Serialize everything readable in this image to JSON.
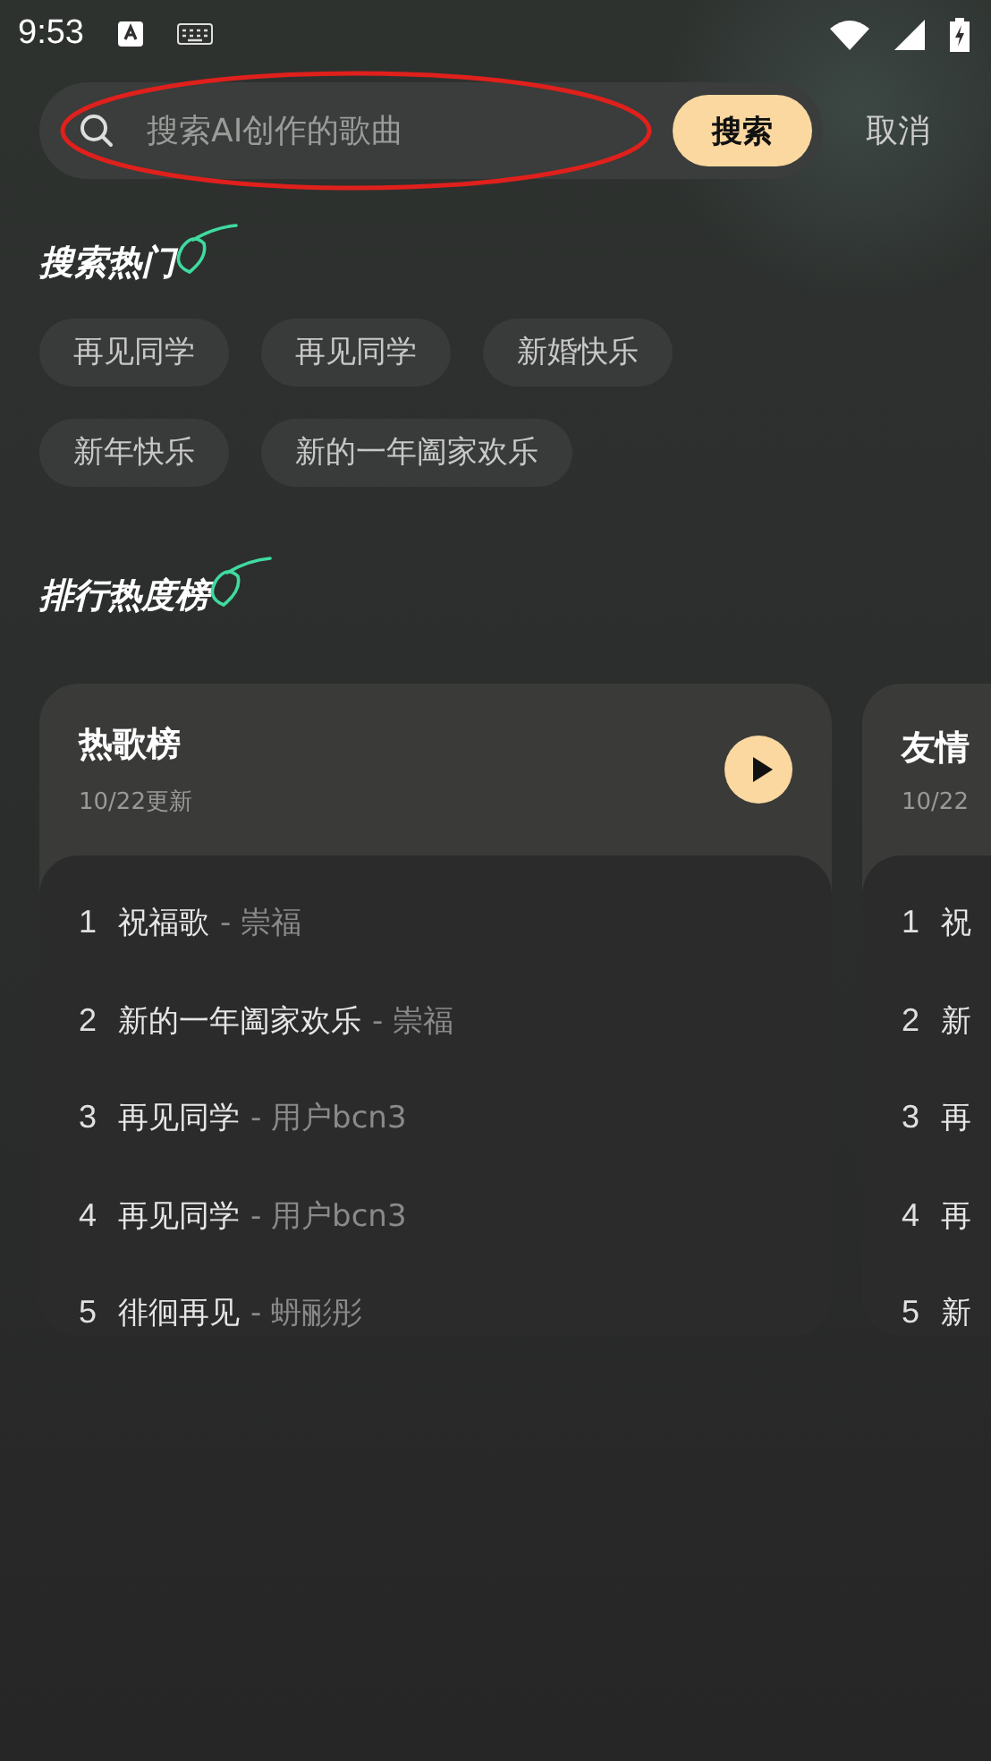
{
  "status_bar": {
    "time": "9:53"
  },
  "search": {
    "placeholder": "搜索AI创作的歌曲",
    "button": "搜索",
    "cancel": "取消",
    "annotation": {
      "kind": "ellipse"
    }
  },
  "hot_search": {
    "title": "搜索热门",
    "tags": [
      "再见同学",
      "再见同学",
      "新婚快乐",
      "新年快乐",
      "新的一年阖家欢乐"
    ]
  },
  "rankings": {
    "title": "排行热度榜",
    "charts": [
      {
        "name": "热歌榜",
        "updated": "10/22更新",
        "play": true,
        "songs": [
          {
            "rank": "1",
            "title": "祝福歌",
            "artist": "- 崇福"
          },
          {
            "rank": "2",
            "title": "新的一年阖家欢乐",
            "artist": "- 崇福"
          },
          {
            "rank": "3",
            "title": "再见同学",
            "artist": "- 用户bcn3"
          },
          {
            "rank": "4",
            "title": "再见同学",
            "artist": "- 用户bcn3"
          },
          {
            "rank": "5",
            "title": "徘徊再见",
            "artist": "- 蚒彨彤"
          }
        ]
      },
      {
        "name": "友情",
        "updated": "10/22",
        "play": false,
        "songs": [
          {
            "rank": "1",
            "title": "祝"
          },
          {
            "rank": "2",
            "title": "新"
          },
          {
            "rank": "3",
            "title": "再"
          },
          {
            "rank": "4",
            "title": "再"
          },
          {
            "rank": "5",
            "title": "新"
          }
        ]
      }
    ]
  }
}
